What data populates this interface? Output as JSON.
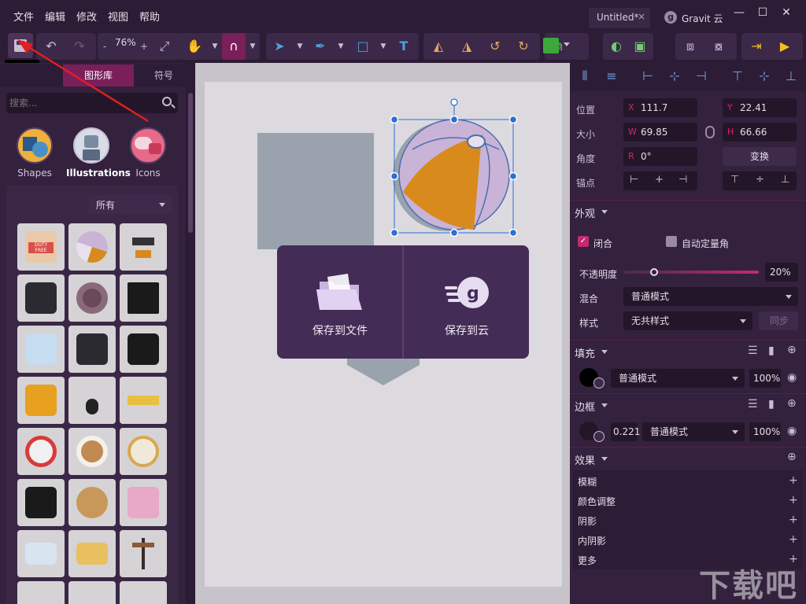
{
  "menu": [
    "文件",
    "编辑",
    "修改",
    "视图",
    "帮助"
  ],
  "tabs": {
    "doc": "Untitled*",
    "doc_close": "×",
    "cloud": "Gravit 云"
  },
  "window": {
    "min": "—",
    "max": "☐",
    "close": "✕"
  },
  "toolbar": {
    "zoom": "76%",
    "zoom_minus": "-",
    "zoom_plus": "+",
    "save_tooltip": "保存"
  },
  "left": {
    "tabs": [
      "图形库",
      "符号"
    ],
    "search_placeholder": "搜索...",
    "categories": [
      "Shapes",
      "Illustrations",
      "Icons"
    ],
    "filter": "所有",
    "thumb_labels": [
      "DUTY FREE"
    ]
  },
  "dialog": {
    "file": "保存到文件",
    "cloud": "保存到云"
  },
  "right": {
    "pos_label": "位置",
    "x_key": "X",
    "x_val": "111.7",
    "y_key": "Y",
    "y_val": "22.41",
    "size_label": "大小",
    "w_key": "W",
    "w_val": "69.85",
    "h_key": "H",
    "h_val": "66.66",
    "angle_label": "角度",
    "r_key": "R",
    "r_val": "0°",
    "transform": "变换",
    "anchor_label": "锚点",
    "appearance": "外观",
    "close_label": "闭合",
    "auto_corner": "自动定量角",
    "opacity_label": "不透明度",
    "opacity_val": "20%",
    "blend_label": "混合",
    "blend_val": "普通模式",
    "style_label": "样式",
    "style_val": "无共样式",
    "sync": "同步",
    "fill": "填充",
    "fill_mode": "普通模式",
    "fill_pct": "100%",
    "border": "边框",
    "border_w": "0.221",
    "border_mode": "普通模式",
    "border_pct": "100%",
    "effects": "效果",
    "effect_items": [
      "模糊",
      "颜色调整",
      "阴影",
      "内阴影",
      "更多"
    ]
  },
  "watermark": "下载吧",
  "colors": {
    "accent": "#d4246b",
    "panel": "#33213d",
    "dialog": "#432c56",
    "ball_orange": "#d88a1c",
    "ball_lilac": "#c9b3d6"
  }
}
